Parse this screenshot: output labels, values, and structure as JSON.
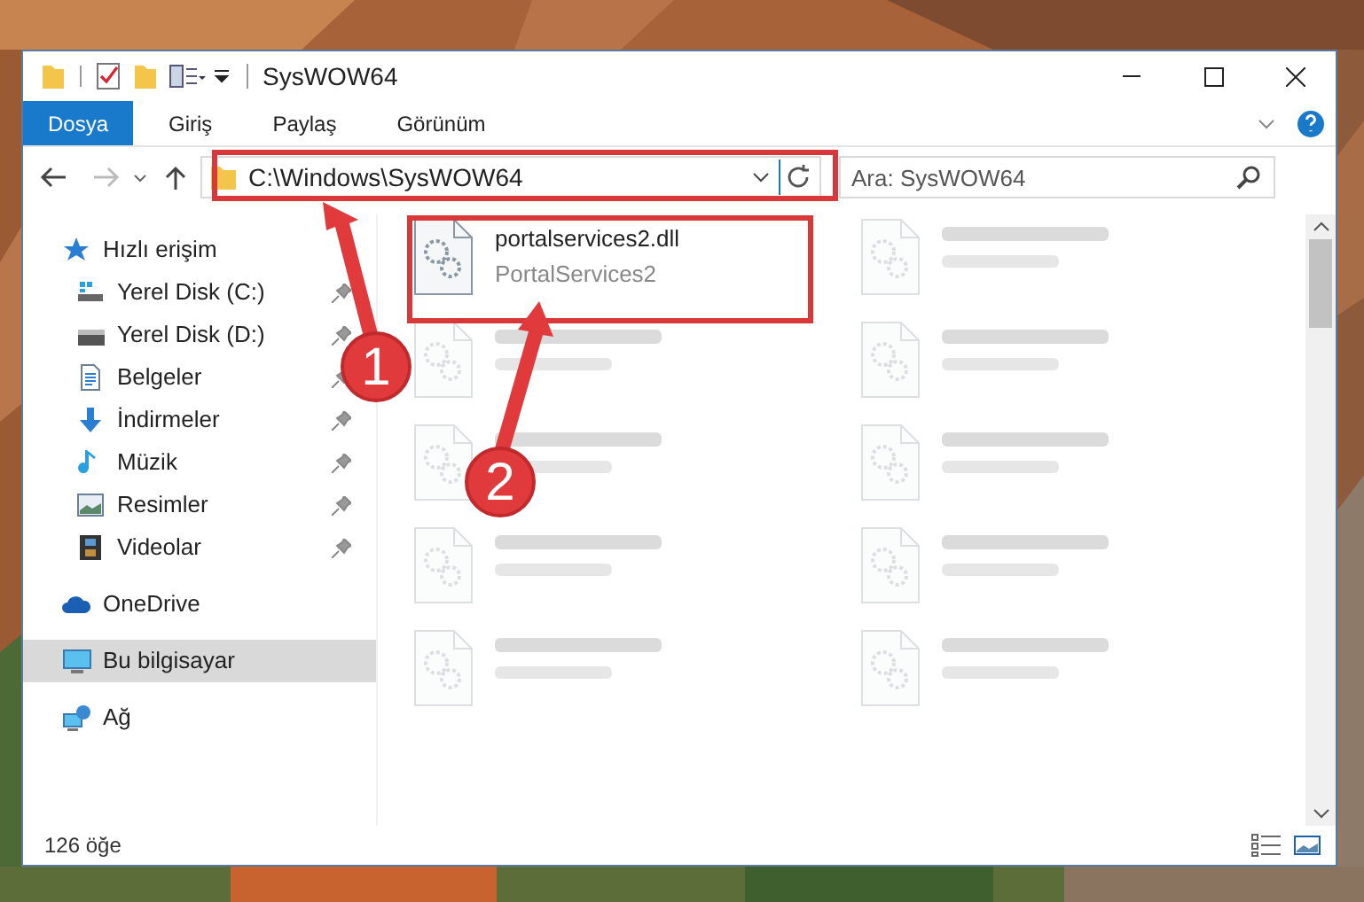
{
  "window": {
    "title": "SysWOW64"
  },
  "ribbon": {
    "tabs": [
      {
        "label": "Dosya",
        "selected": true
      },
      {
        "label": "Giriş",
        "selected": false
      },
      {
        "label": "Paylaş",
        "selected": false
      },
      {
        "label": "Görünüm",
        "selected": false
      }
    ]
  },
  "address_bar": {
    "path": "C:\\Windows\\SysWOW64"
  },
  "search": {
    "placeholder": "Ara: SysWOW64"
  },
  "sidebar": {
    "items": [
      {
        "label": "Hızlı erişim",
        "kind": "star",
        "selected": false,
        "children": [
          {
            "label": "Yerel Disk (C:)",
            "kind": "disk-c",
            "selected": false,
            "pinned": true
          },
          {
            "label": "Yerel Disk (D:)",
            "kind": "disk",
            "selected": false,
            "pinned": true
          },
          {
            "label": "Belgeler",
            "kind": "doc",
            "selected": false,
            "pinned": true
          },
          {
            "label": "İndirmeler",
            "kind": "down",
            "selected": false,
            "pinned": true
          },
          {
            "label": "Müzik",
            "kind": "music",
            "selected": false,
            "pinned": true
          },
          {
            "label": "Resimler",
            "kind": "pictures",
            "selected": false,
            "pinned": true
          },
          {
            "label": "Videolar",
            "kind": "video",
            "selected": false,
            "pinned": true
          }
        ]
      },
      {
        "label": "OneDrive",
        "kind": "cloud",
        "selected": false
      },
      {
        "label": "Bu bilgisayar",
        "kind": "pc",
        "selected": true
      },
      {
        "label": "Ağ",
        "kind": "network",
        "selected": false
      }
    ]
  },
  "files": [
    {
      "kind": "file",
      "name": "portalservices2.dll",
      "description": "PortalServices2"
    },
    {
      "kind": "blurred"
    },
    {
      "kind": "blurred"
    },
    {
      "kind": "blurred"
    },
    {
      "kind": "blurred"
    },
    {
      "kind": "blurred"
    },
    {
      "kind": "blurred"
    },
    {
      "kind": "blurred"
    },
    {
      "kind": "blurred"
    },
    {
      "kind": "blurred"
    }
  ],
  "status_bar": {
    "count": "126 öğe"
  },
  "annotations": [
    {
      "number": "1"
    },
    {
      "number": "2"
    }
  ]
}
